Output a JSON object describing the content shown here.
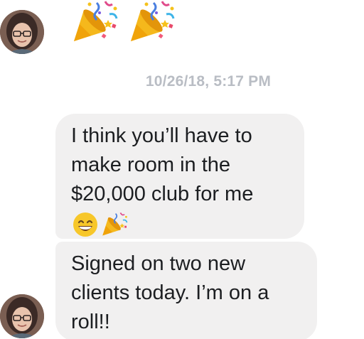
{
  "conversation": {
    "top_emojis": [
      "party-popper",
      "party-popper"
    ],
    "timestamp": "10/26/18, 5:17 PM",
    "messages": [
      {
        "lines": [
          "I think you’ll have to",
          "make room in the",
          "$20,000 club for me"
        ],
        "emojis": [
          "grinning-smiling-eyes",
          "party-popper"
        ]
      },
      {
        "lines": [
          "Signed on two new",
          "clients today. I’m on a",
          "roll!!"
        ]
      }
    ]
  },
  "colors": {
    "bubble_bg": "#f1f0f0",
    "text": "#1c1e21",
    "timestamp": "#b9bdc4"
  }
}
